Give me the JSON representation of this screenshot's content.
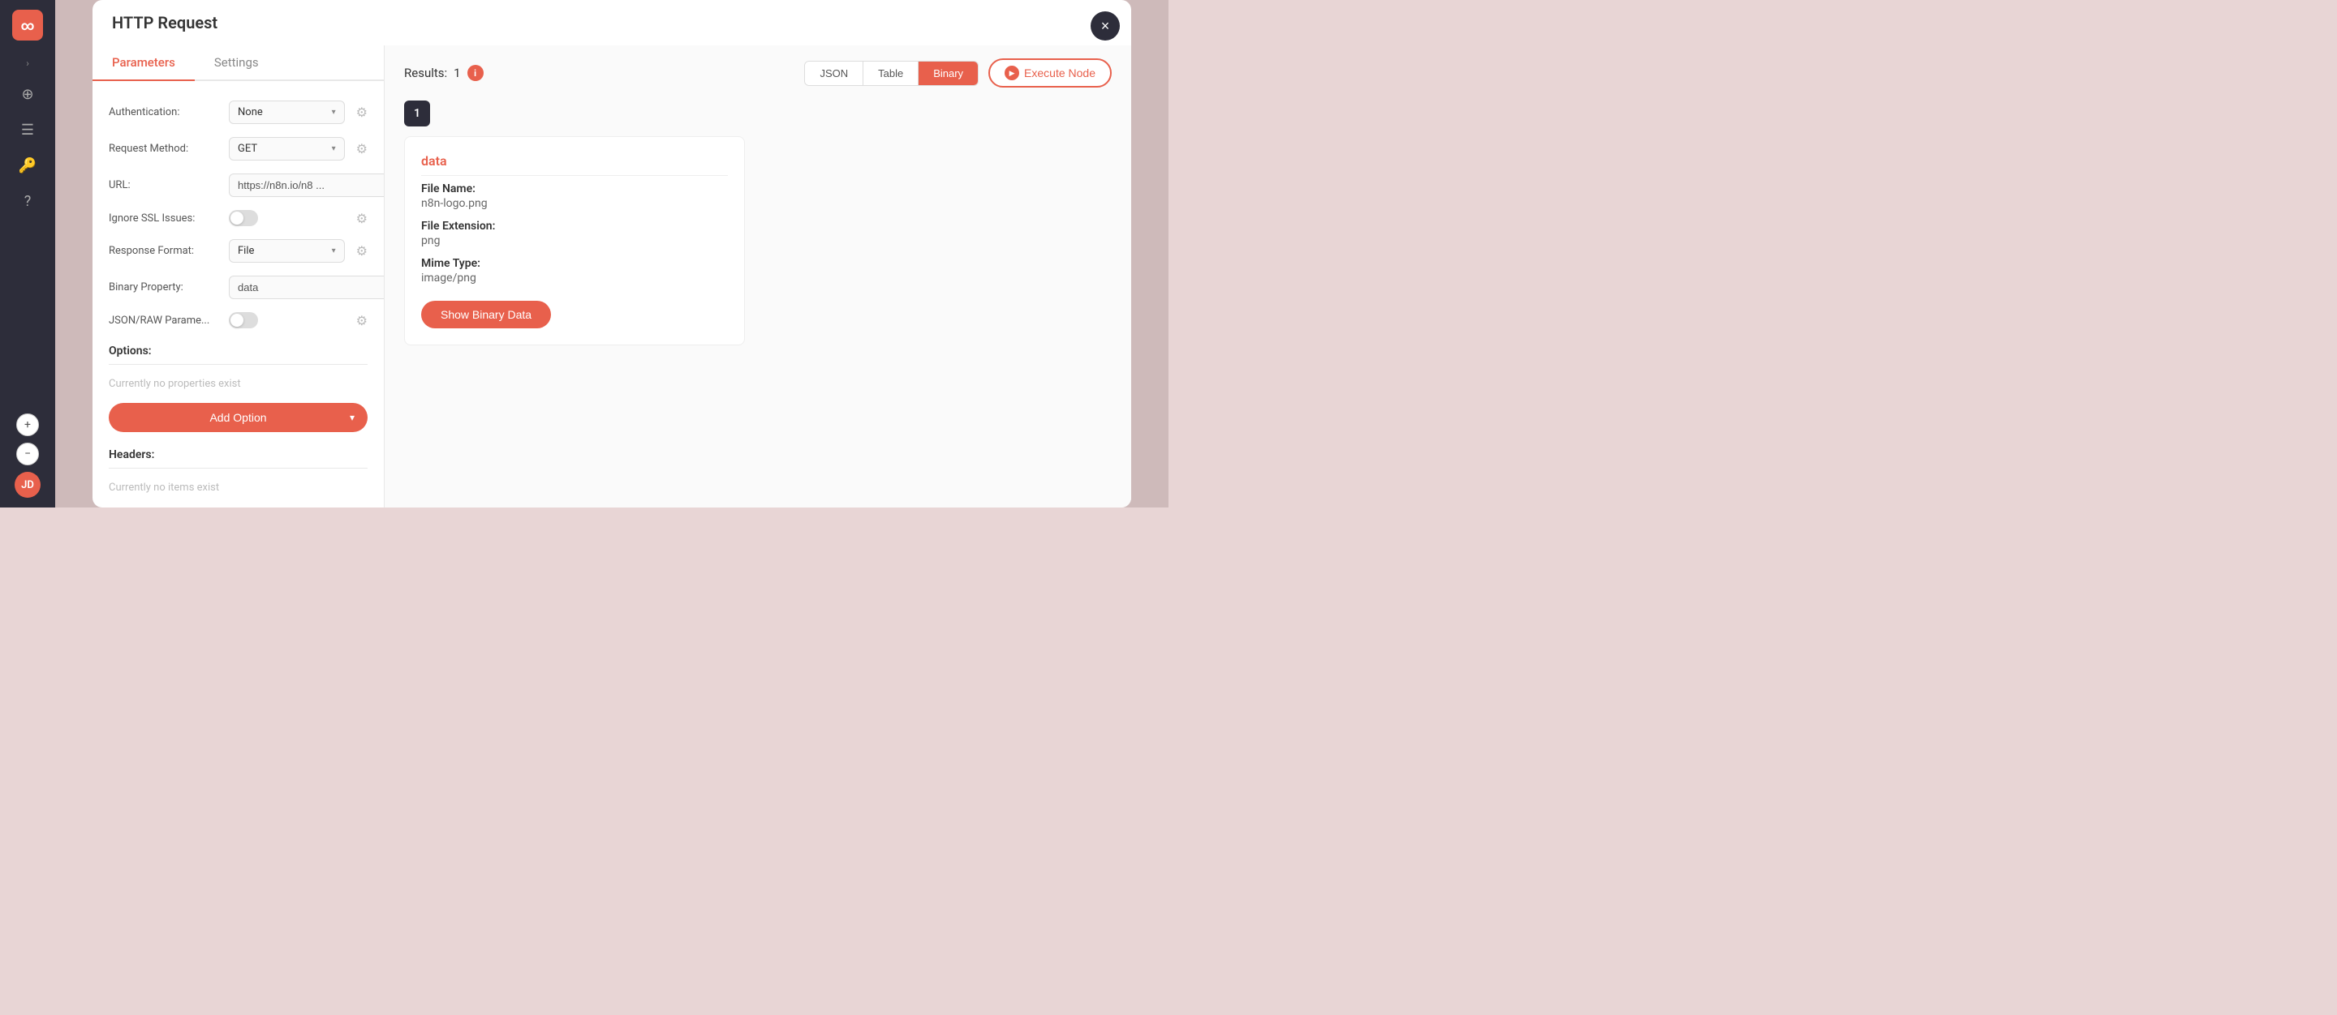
{
  "sidebar": {
    "logo_text": "∞",
    "chevron": "›",
    "icons": [
      "⊕",
      "☰",
      "⚑",
      "?"
    ],
    "avatar_text": "JD"
  },
  "modal": {
    "title": "HTTP Request",
    "close_icon": "×",
    "left_panel": {
      "tabs": [
        {
          "label": "Parameters",
          "active": true
        },
        {
          "label": "Settings",
          "active": false
        }
      ],
      "fields": [
        {
          "label": "Authentication:",
          "type": "select",
          "value": "None"
        },
        {
          "label": "Request Method:",
          "type": "select",
          "value": "GET"
        },
        {
          "label": "URL:",
          "type": "text",
          "value": "https://n8n.io/n8 ..."
        },
        {
          "label": "Ignore SSL Issues:",
          "type": "toggle",
          "value": false
        },
        {
          "label": "Response Format:",
          "type": "select",
          "value": "File"
        },
        {
          "label": "Binary Property:",
          "type": "text",
          "value": "data"
        },
        {
          "label": "JSON/RAW Parame...",
          "type": "toggle",
          "value": false
        }
      ],
      "options_section": {
        "label": "Options:",
        "empty_text": "Currently no properties exist",
        "add_button_label": "Add Option"
      },
      "headers_section": {
        "label": "Headers:",
        "empty_text": "Currently no items exist"
      }
    },
    "right_panel": {
      "results_label": "Results:",
      "results_count": "1",
      "view_tabs": [
        {
          "label": "JSON",
          "active": false
        },
        {
          "label": "Table",
          "active": false
        },
        {
          "label": "Binary",
          "active": true
        }
      ],
      "execute_button_label": "Execute Node",
      "selected_item": "1",
      "data_card": {
        "title": "data",
        "fields": [
          {
            "label": "File Name:",
            "value": "n8n-logo.png"
          },
          {
            "label": "File Extension:",
            "value": "png"
          },
          {
            "label": "Mime Type:",
            "value": "image/png"
          }
        ],
        "show_binary_label": "Show Binary Data"
      }
    }
  },
  "zoom": {
    "zoom_in_icon": "+",
    "zoom_out_icon": "−"
  }
}
